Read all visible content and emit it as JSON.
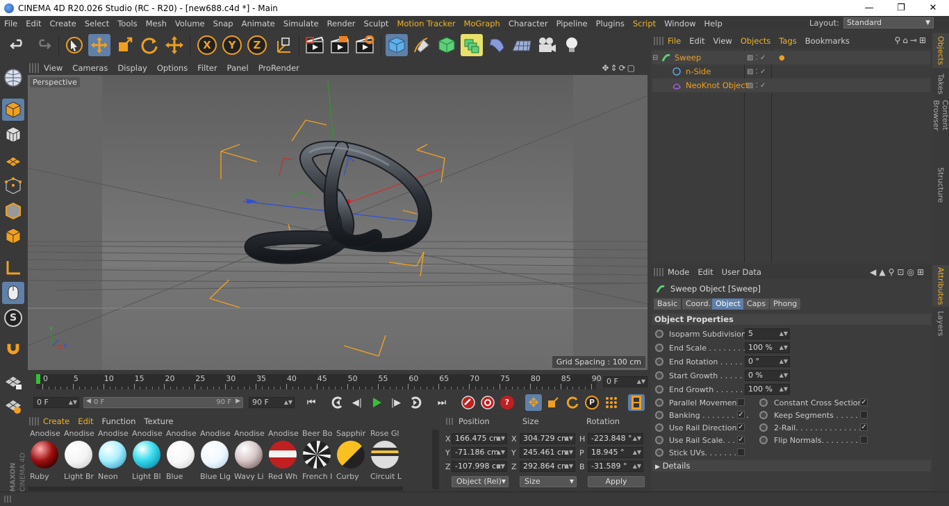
{
  "window": {
    "title": "CINEMA 4D R20.026 Studio (RC - R20) - [new688.c4d *] - Main",
    "controls": [
      "—",
      "❐",
      "✕"
    ]
  },
  "menubar": {
    "items": [
      "File",
      "Edit",
      "Create",
      "Select",
      "Tools",
      "Mesh",
      "Volume",
      "Snap",
      "Animate",
      "Simulate",
      "Render",
      "Sculpt",
      "Motion Tracker",
      "MoGraph",
      "Character",
      "Pipeline",
      "Plugins",
      "Script",
      "Window",
      "Help"
    ],
    "layout_label": "Layout:",
    "layout_value": "Standard"
  },
  "toolbar": {
    "axis_labels": [
      "X",
      "Y",
      "Z"
    ]
  },
  "viewport": {
    "menu": [
      "View",
      "Cameras",
      "Display",
      "Options",
      "Filter",
      "Panel",
      "ProRender"
    ],
    "camera_label": "Perspective",
    "grid_spacing": "Grid Spacing : 100 cm",
    "axis_y": "Y",
    "axis_z": "Z",
    "axis_x": "X"
  },
  "timeline": {
    "ticks": [
      "0",
      "5",
      "10",
      "15",
      "20",
      "25",
      "30",
      "35",
      "40",
      "45",
      "50",
      "55",
      "60",
      "65",
      "70",
      "75",
      "80",
      "85",
      "90"
    ],
    "current_frame": "0 F",
    "start_frame": "0 F",
    "range_start": "0 F",
    "range_end": "90 F",
    "end_frame": "90 F"
  },
  "materials": {
    "menu": [
      "Create",
      "Edit",
      "Function",
      "Texture"
    ],
    "top_row": [
      "Anodise",
      "Anodise",
      "Anodise",
      "Anodise",
      "Anodise",
      "Anodise",
      "Anodise",
      "Anodise",
      "Beer Bo",
      "Sapphir",
      "Rose Gl"
    ],
    "names": [
      "Ruby",
      "Light Br",
      "Neon",
      "Light Bl",
      "Blue",
      "Blue Lig",
      "Wavy Li",
      "Red Wh",
      "French I",
      "Curby",
      "Circuit L"
    ]
  },
  "coordinates": {
    "headers": [
      "Position",
      "Size",
      "Rotation"
    ],
    "rows": [
      {
        "axis": "X",
        "position": "166.475 cm",
        "size_axis": "X",
        "size": "304.729 cm",
        "rot_axis": "H",
        "rotation": "-223.848 °"
      },
      {
        "axis": "Y",
        "position": "-71.186 cm",
        "size_axis": "Y",
        "size": "245.461 cm",
        "rot_axis": "P",
        "rotation": "18.945 °"
      },
      {
        "axis": "Z",
        "position": "-107.998 cm",
        "size_axis": "Z",
        "size": "292.864 cm",
        "rot_axis": "B",
        "rotation": "-31.589 °"
      }
    ],
    "mode": "Object (Rel)",
    "size_mode": "Size",
    "apply": "Apply"
  },
  "objects": {
    "menu": [
      "File",
      "Edit",
      "View",
      "Objects",
      "Tags",
      "Bookmarks"
    ],
    "items": [
      {
        "name": "Sweep",
        "indent": 0
      },
      {
        "name": "n-Side",
        "indent": 1
      },
      {
        "name": "NeoKnot Object",
        "indent": 1
      }
    ]
  },
  "side_tabs_top": [
    "Objects",
    "Takes",
    "Content Browser",
    "Structure"
  ],
  "side_tabs_bottom": [
    "Attributes",
    "Layers"
  ],
  "attributes": {
    "menu": [
      "Mode",
      "Edit",
      "User Data"
    ],
    "object_title": "Sweep Object [Sweep]",
    "tabs": [
      "Basic",
      "Coord.",
      "Object",
      "Caps",
      "Phong"
    ],
    "section": "Object Properties",
    "fields": [
      {
        "label": "Isoparm Subdivision",
        "value": "5"
      },
      {
        "label": "End Scale . . . . . . . . . .",
        "value": "100 %"
      },
      {
        "label": "End Rotation . . . . . .",
        "value": "0 °"
      },
      {
        "label": "Start Growth . . . . . .",
        "value": "0 %"
      },
      {
        "label": "End Growth . . . . . . .",
        "value": "100 %"
      }
    ],
    "checks_left": [
      {
        "label": "Parallel Movement",
        "checked": false
      },
      {
        "label": "Banking . . . . . . . . . .",
        "checked": true
      },
      {
        "label": "Use Rail Direction",
        "checked": true
      },
      {
        "label": "Use Rail Scale. . . .",
        "checked": true
      },
      {
        "label": "Stick UVs. . . . . . . .",
        "checked": false
      }
    ],
    "checks_right": [
      {
        "label": "Constant Cross Section",
        "checked": true
      },
      {
        "label": "Keep Segments . . . . . . .",
        "checked": false
      },
      {
        "label": "2-Rail. . . . . . . . . . . . . . .",
        "checked": true
      },
      {
        "label": "Flip Normals. . . . . . . . .",
        "checked": false
      }
    ],
    "details": "Details",
    "checkmark": "✓"
  },
  "brand": {
    "maxon": "MAXON",
    "product": "CINEMA 4D"
  },
  "colors": {
    "accent": "#f0b429",
    "selected": "#5f80a8",
    "object_name": "#f0a020"
  }
}
